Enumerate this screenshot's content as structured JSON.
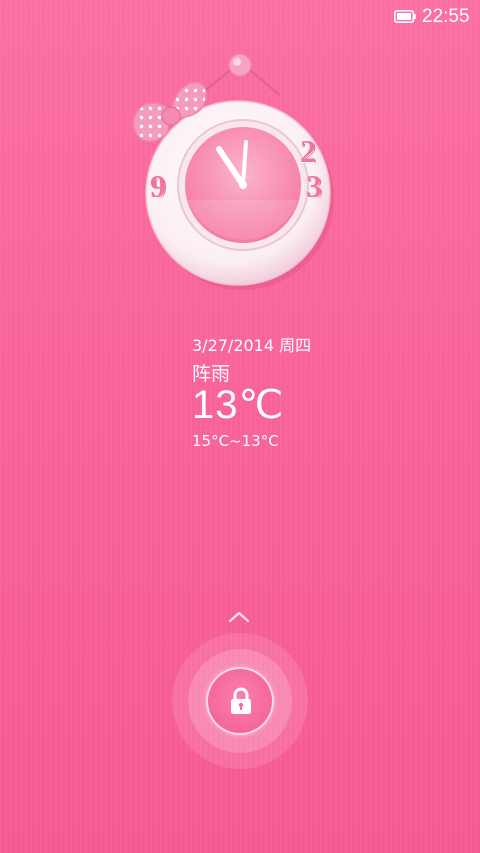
{
  "status_bar": {
    "time": "22:55",
    "battery_icon": "battery-icon"
  },
  "clock": {
    "numerals": {
      "twelve": "2",
      "three": "3",
      "nine": "9"
    },
    "time_shown": "11:05",
    "icons": [
      "bow-icon",
      "hanger-icon"
    ]
  },
  "weather": {
    "date": "3/27/2014 周四",
    "condition": "阵雨",
    "temperature": "13℃",
    "range": "15°C~13°C"
  },
  "unlock": {
    "arrow_icon": "chevron-up-icon",
    "lock_icon": "lock-icon"
  },
  "colors": {
    "background": "#f8639a",
    "accent": "#fb7fad",
    "text": "#ffffff"
  }
}
